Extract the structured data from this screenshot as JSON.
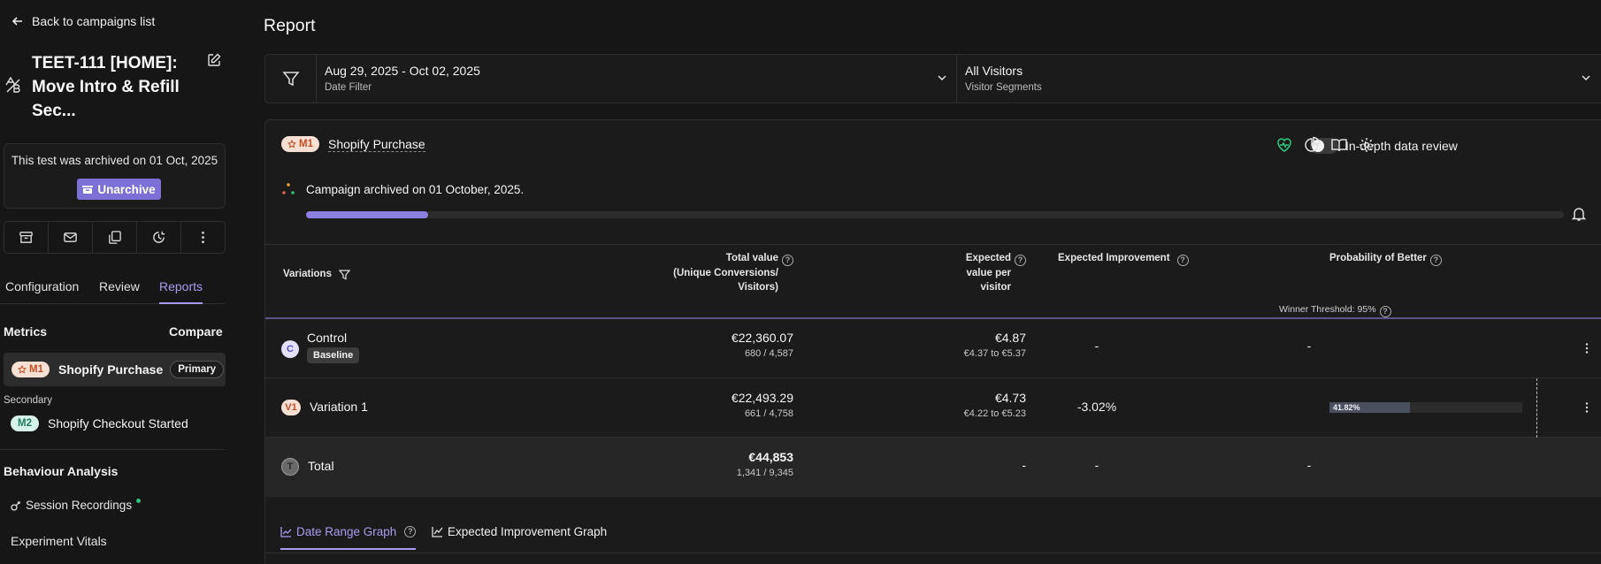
{
  "sidebar": {
    "back_label": "Back to campaigns list",
    "test_title": "TEET-111 [HOME]: Move Intro & Refill Sec...",
    "archive_notice": "This test was archived on 01 Oct, 2025",
    "unarchive_label": "Unarchive",
    "actions": [
      "archive-icon",
      "mail-icon",
      "copy-icon",
      "history-icon",
      "more-vertical-icon"
    ],
    "tabs": [
      "Configuration",
      "Review",
      "Reports"
    ],
    "active_tab": "Reports",
    "metrics_label": "Metrics",
    "compare_label": "Compare",
    "primary_metric": {
      "badge": "M1",
      "name": "Shopify Purchase",
      "tag": "Primary"
    },
    "secondary_label": "Secondary",
    "secondary_metric": {
      "badge": "M2",
      "name": "Shopify Checkout Started"
    },
    "behaviour_label": "Behaviour Analysis",
    "session_recordings": "Session Recordings",
    "experiment_vitals": "Experiment Vitals"
  },
  "main": {
    "title": "Report",
    "date_filter": {
      "value": "Aug 29, 2025 - Oct 02, 2025",
      "label": "Date Filter"
    },
    "segments": {
      "value": "All Visitors",
      "label": "Visitor Segments"
    },
    "card": {
      "metric_badge": "M1",
      "metric_name": "Shopify Purchase",
      "toggle_label": "In-depth data review",
      "toggle_on": false,
      "archived_text": "Campaign archived on 01 October, 2025.",
      "progress": 0.097,
      "columns": {
        "variations": "Variations",
        "total_value_1": "Total value",
        "total_value_2": "(Unique Conversions/",
        "total_value_3": "Visitors)",
        "expected_1": "Expected",
        "expected_2": "value per",
        "expected_3": "visitor",
        "improvement": "Expected Improvement",
        "probability": "Probability of Better"
      },
      "winner_threshold": "Winner Threshold: 95%",
      "rows": [
        {
          "badge": "C",
          "name": "Control",
          "tag": "Baseline",
          "total": "€22,360.07",
          "ratio": "680 / 4,587",
          "expected": "€4.87",
          "range": "€4.37 to €5.37",
          "improvement": "-",
          "probability": "-"
        },
        {
          "badge": "V1",
          "name": "Variation 1",
          "total": "€22,493.29",
          "ratio": "661 / 4,758",
          "expected": "€4.73",
          "range": "€4.22 to €5.23",
          "improvement": "-3.02%",
          "probability": "41.82%",
          "probability_value": 0.4182
        },
        {
          "badge": "T",
          "name": "Total",
          "total": "€44,853",
          "ratio": "1,341 / 9,345",
          "expected": "-",
          "improvement": "-",
          "probability": "-"
        }
      ],
      "graph_tabs": [
        "Date Range Graph",
        "Expected Improvement Graph"
      ],
      "active_graph_tab": "Date Range Graph"
    }
  },
  "colors": {
    "accent": "#a89cf0",
    "button": "#7c6fd6",
    "m1_bg": "#f6dfd3",
    "m1_fg": "#c24f25",
    "m2_bg": "#d6f2ea",
    "m2_fg": "#1e7a62"
  }
}
